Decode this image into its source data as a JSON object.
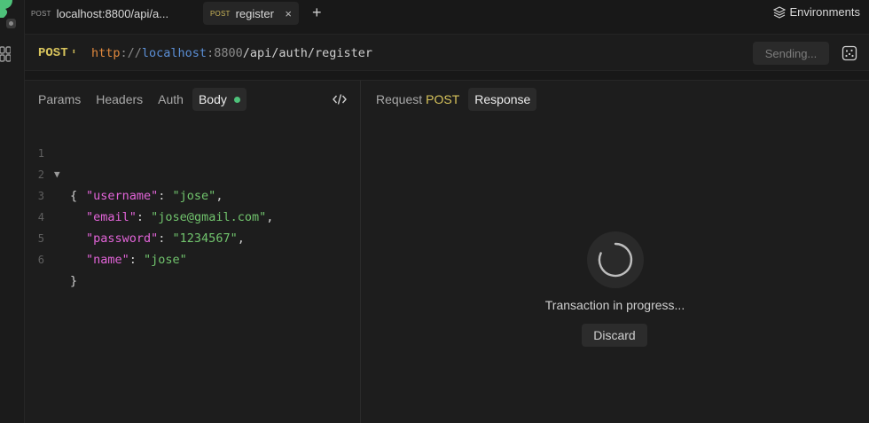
{
  "tabs": [
    {
      "method": "POST",
      "title": "localhost:8800/api/a..."
    },
    {
      "method": "POST",
      "title": "register",
      "close": "×"
    }
  ],
  "new_tab": "+",
  "environments_label": "Environments",
  "request": {
    "method": "POST",
    "method_arrows": "⬍",
    "url": {
      "protocol": "http",
      "separator": "://",
      "host": "localhost",
      "port": ":8800",
      "path": "/api/auth/register"
    },
    "send_label": "Sending..."
  },
  "request_tabs": [
    "Params",
    "Headers",
    "Auth",
    "Body"
  ],
  "active_request_tab": "Body",
  "body_status_color": "#4ec27a",
  "editor": {
    "line_numbers": [
      "1",
      "2",
      "3",
      "4",
      "5",
      "6"
    ],
    "fold_marker": "▼",
    "open_brace": "{",
    "close_brace": "}",
    "fields": [
      {
        "key": "\"username\"",
        "value": "\"jose\"",
        "trail": ","
      },
      {
        "key": "\"email\"",
        "value": "\"jose@gmail.com\"",
        "trail": ","
      },
      {
        "key": "\"password\"",
        "value": "\"1234567\"",
        "trail": ","
      },
      {
        "key": "\"name\"",
        "value": "\"jose\"",
        "trail": ""
      }
    ]
  },
  "response_panel": {
    "request_tab": "Request",
    "request_method": "POST",
    "response_tab": "Response",
    "status_text": "Transaction in progress...",
    "discard_label": "Discard"
  },
  "icons": {
    "logo": "app-logo-icon",
    "environments": "layers-icon",
    "code": "code-icon",
    "cookie": "cookie-icon",
    "spinner": "spinner-icon"
  },
  "colors": {
    "method": "#d8c45c",
    "json_key": "#e264d8",
    "json_string": "#71c46d",
    "protocol": "#e0883d",
    "host": "#5b8fd6"
  }
}
